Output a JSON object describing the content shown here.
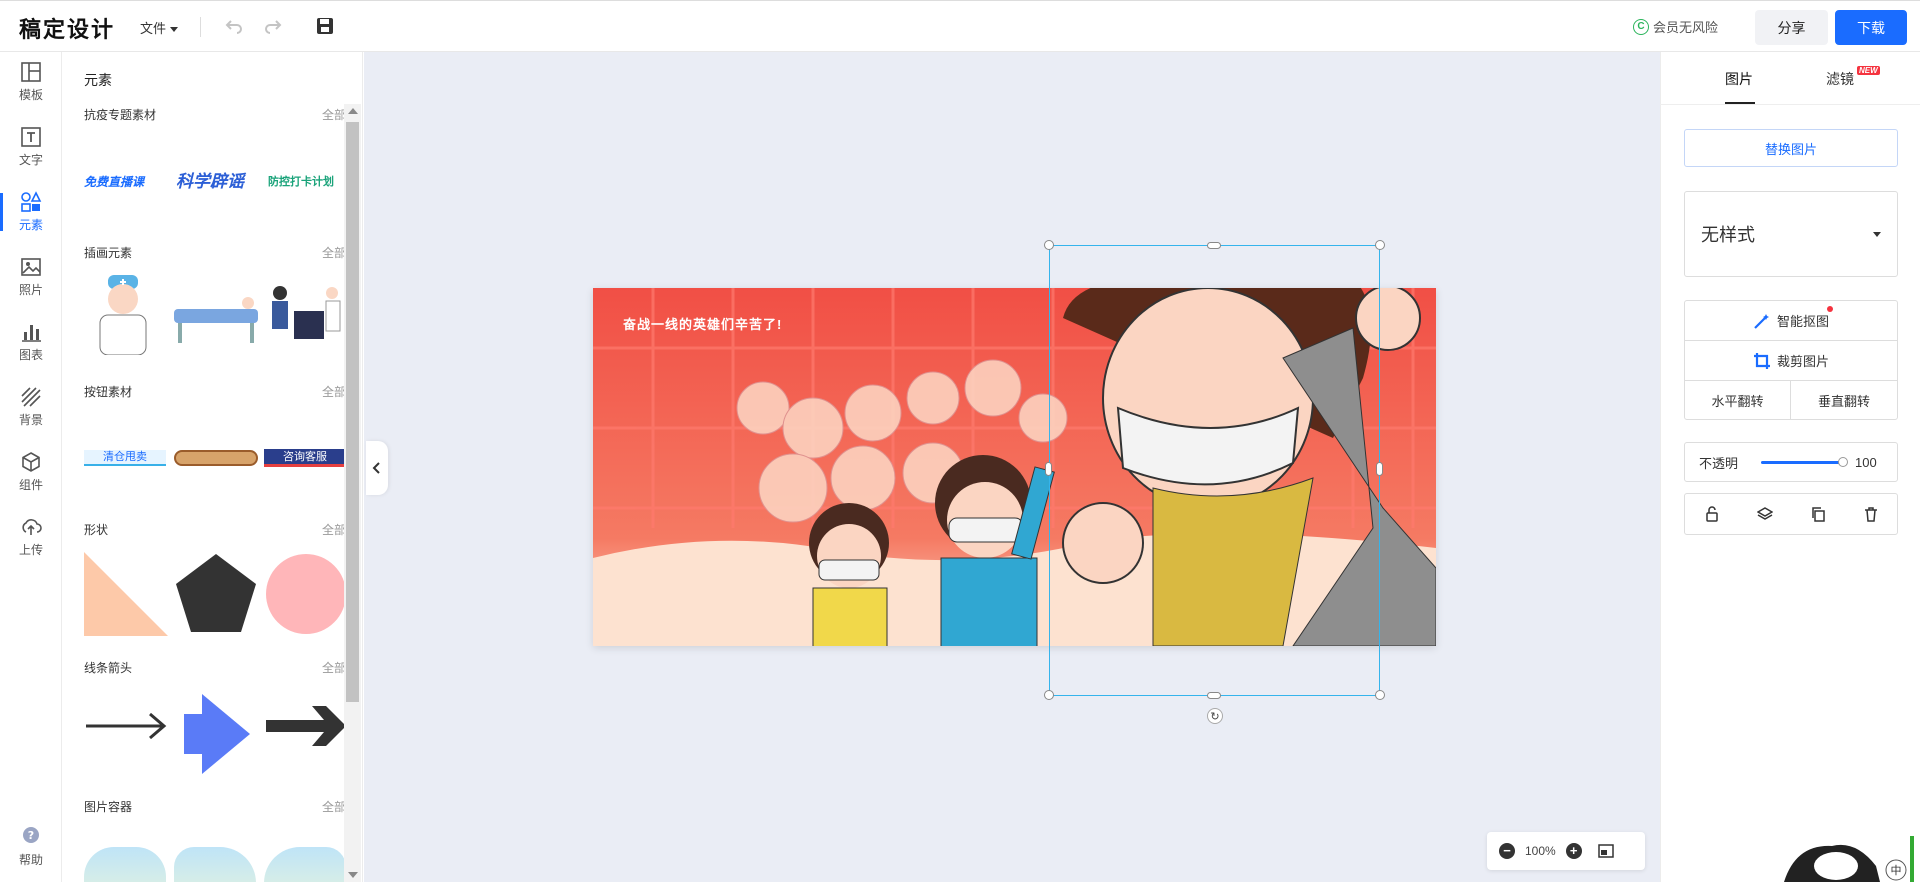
{
  "header": {
    "logo": "稿定设计",
    "file_menu": "文件",
    "vip_label": "会员无风险",
    "share": "分享",
    "download": "下载"
  },
  "rail": {
    "items": [
      {
        "label": "模板",
        "icon": "template-icon"
      },
      {
        "label": "文字",
        "icon": "text-icon"
      },
      {
        "label": "元素",
        "icon": "elements-icon",
        "active": true
      },
      {
        "label": "照片",
        "icon": "photo-icon"
      },
      {
        "label": "图表",
        "icon": "chart-icon"
      },
      {
        "label": "背景",
        "icon": "background-icon"
      },
      {
        "label": "组件",
        "icon": "component-icon"
      },
      {
        "label": "上传",
        "icon": "upload-icon"
      }
    ],
    "help": "帮助"
  },
  "panel": {
    "title": "元素",
    "all_label": "全部",
    "sections": [
      {
        "title": "抗疫专题素材",
        "items": [
          "免费直播课",
          "科学辟谣",
          "防控打卡计划"
        ]
      },
      {
        "title": "插画元素"
      },
      {
        "title": "按钮素材",
        "items": [
          "清仓甩卖",
          "",
          "咨询客服"
        ]
      },
      {
        "title": "形状"
      },
      {
        "title": "线条箭头"
      },
      {
        "title": "图片容器"
      }
    ]
  },
  "canvas": {
    "artboard_text": "奋战一线的英雄们辛苦了!",
    "zoom": "100%"
  },
  "right_panel": {
    "tabs": [
      "图片",
      "滤镜"
    ],
    "new_badge": "NEW",
    "replace": "替换图片",
    "style": "无样式",
    "smart_cutout": "智能抠图",
    "crop": "裁剪图片",
    "flip_h": "水平翻转",
    "flip_v": "垂直翻转",
    "opacity_label": "不透明",
    "opacity_value": "100"
  }
}
